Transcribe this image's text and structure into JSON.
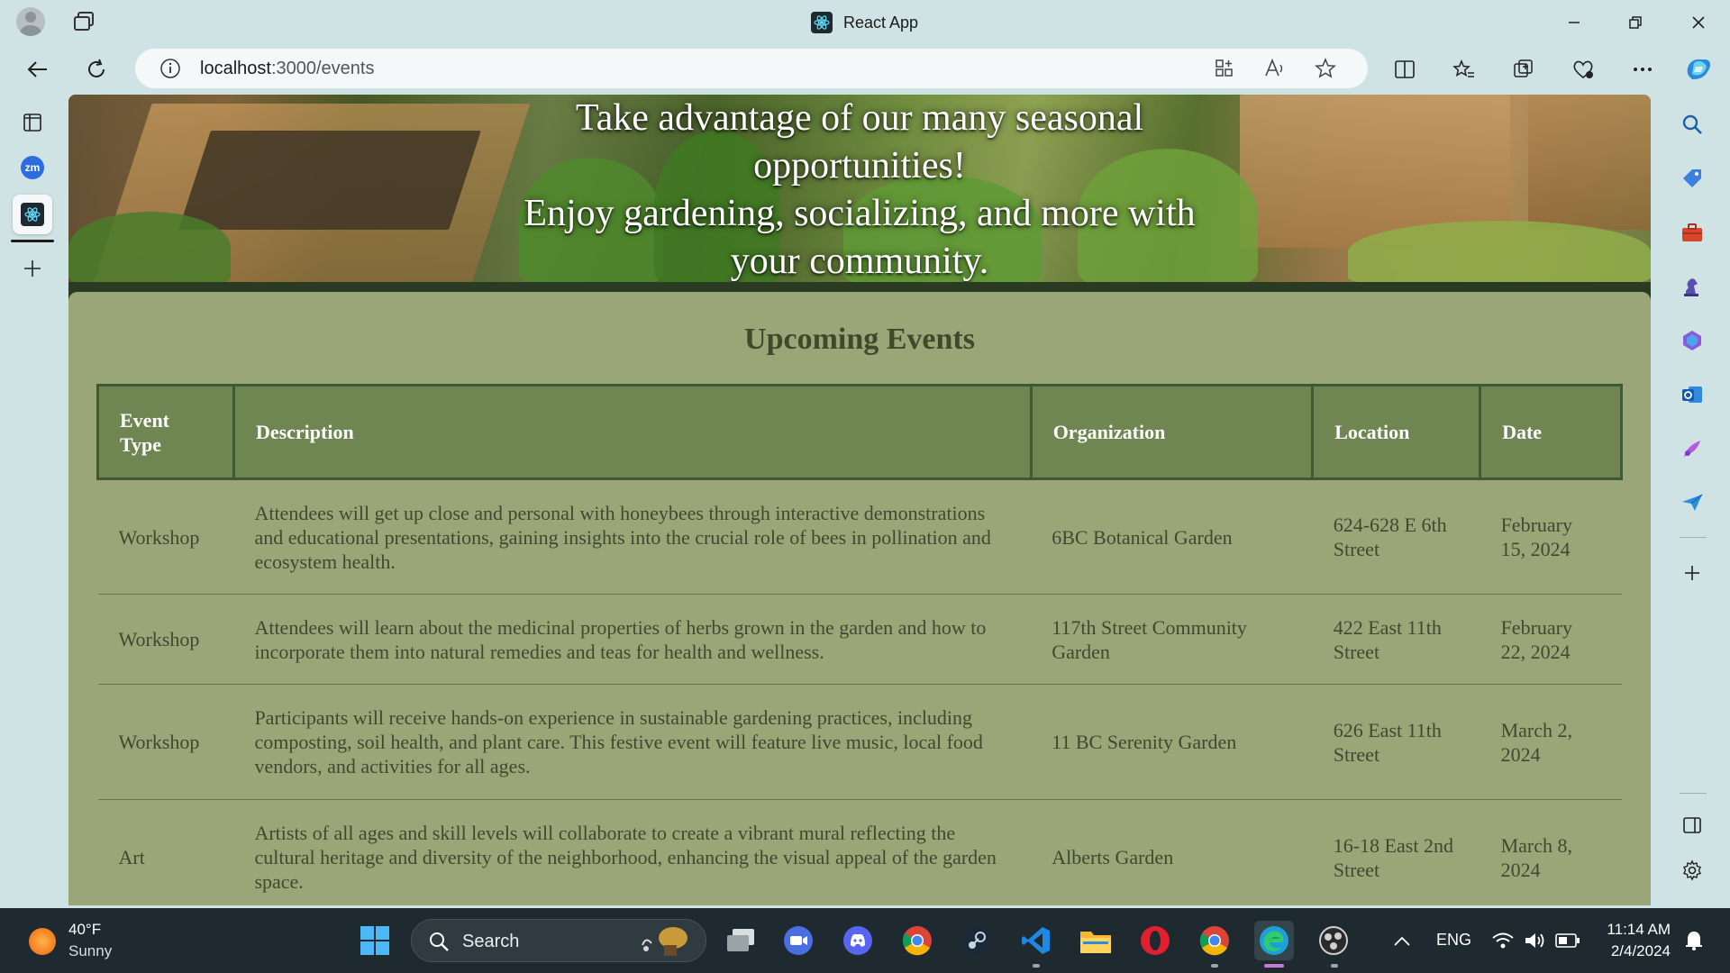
{
  "window": {
    "title": "React App"
  },
  "address_bar": {
    "host": "localhost",
    "path": ":3000/events"
  },
  "hero": {
    "line1": "Take advantage of our many seasonal opportunities!",
    "line2": "Enjoy gardening, socializing, and more with your community."
  },
  "events": {
    "heading": "Upcoming Events",
    "columns": {
      "type": "Event Type",
      "description": "Description",
      "organization": "Organization",
      "location": "Location",
      "date": "Date"
    },
    "rows": [
      {
        "type": "Workshop",
        "description": "Attendees will get up close and personal with honeybees through interactive demonstrations and educational presentations, gaining insights into the crucial role of bees in pollination and ecosystem health.",
        "organization": "6BC Botanical Garden",
        "location": "624-628 E 6th Street",
        "date": "February 15, 2024"
      },
      {
        "type": "Workshop",
        "description": "Attendees will learn about the medicinal properties of herbs grown in the garden and how to incorporate them into natural remedies and teas for health and wellness.",
        "organization": "117th Street Community Garden",
        "location": "422 East 11th Street",
        "date": "February 22, 2024"
      },
      {
        "type": "Workshop",
        "description": "Participants will receive hands-on experience in sustainable gardening practices, including composting, soil health, and plant care. This festive event will feature live music, local food vendors, and activities for all ages.",
        "organization": "11 BC Serenity Garden",
        "location": "626 East 11th Street",
        "date": "March 2, 2024"
      },
      {
        "type": "Art",
        "description": "Artists of all ages and skill levels will collaborate to create a vibrant mural reflecting the cultural heritage and diversity of the neighborhood, enhancing the visual appeal of the garden space.",
        "organization": "Alberts Garden",
        "location": "16-18 East 2nd Street",
        "date": "March 8, 2024"
      }
    ]
  },
  "left_tabs": {
    "zoom_badge": "zm"
  },
  "taskbar": {
    "weather_temp": "40°F",
    "weather_cond": "Sunny",
    "search_label": "Search",
    "language": "ENG",
    "time": "11:14 AM",
    "date": "2/4/2024"
  },
  "colors": {
    "header_green": "#6f8552",
    "panel_olive": "#9ba678",
    "heading_text": "#3e4a2a",
    "chrome_teal": "#cfe3e4",
    "taskbar_dark": "#1e2a2f"
  }
}
